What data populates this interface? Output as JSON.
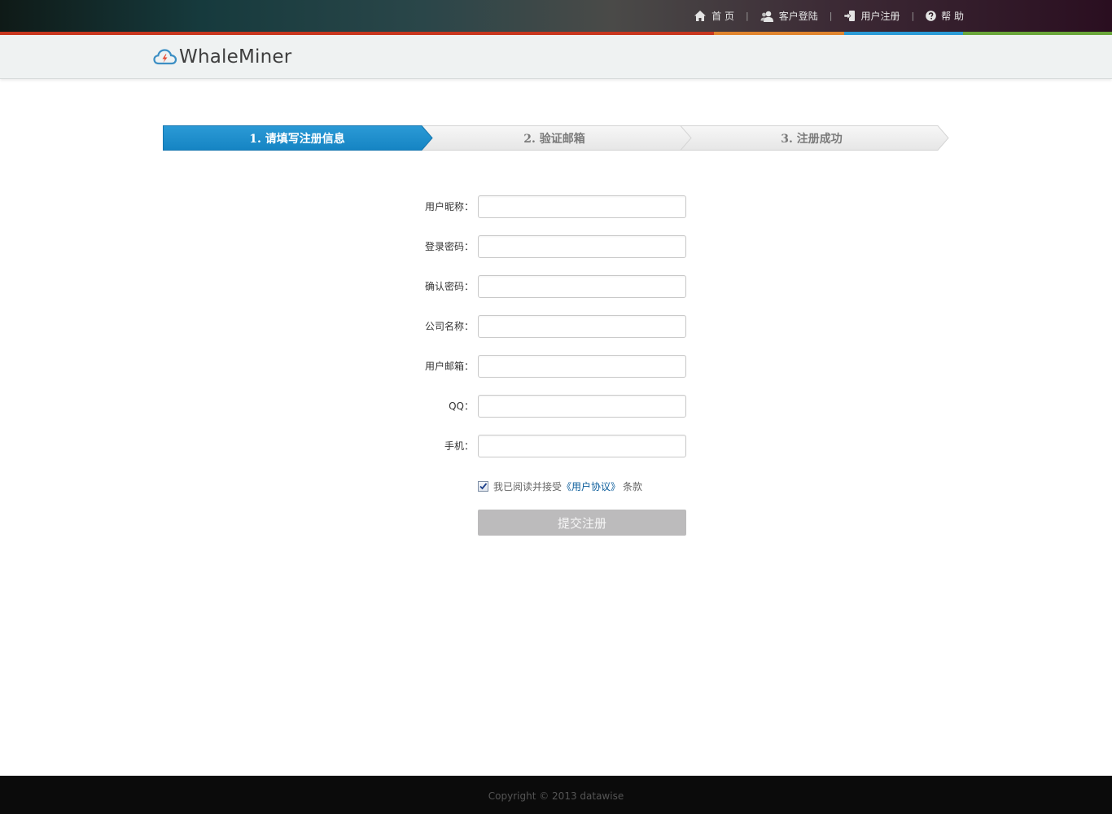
{
  "topnav": {
    "home": "首 页",
    "login": "客户登陆",
    "register": "用户注册",
    "help": "帮 助",
    "separator": "|"
  },
  "colors": {
    "accent_blue": "#1a8bc8",
    "stripe_red": "#c8371f",
    "stripe_orange": "#e0852e",
    "stripe_blue": "#2a9bd6",
    "stripe_green": "#6aa63a",
    "button_disabled": "#bcbbbc",
    "link": "#0a5c9b"
  },
  "header": {
    "logo_text": "WhaleMiner"
  },
  "steps": [
    {
      "label": "1. 请填写注册信息",
      "active": true
    },
    {
      "label": "2. 验证邮箱",
      "active": false
    },
    {
      "label": "3. 注册成功",
      "active": false
    }
  ],
  "form": {
    "fields": [
      {
        "label": "用户昵称：",
        "value": ""
      },
      {
        "label": "登录密码：",
        "value": ""
      },
      {
        "label": "确认密码：",
        "value": ""
      },
      {
        "label": "公司名称：",
        "value": ""
      },
      {
        "label": "用户邮箱：",
        "value": ""
      },
      {
        "label": "QQ：",
        "value": ""
      },
      {
        "label": "手机：",
        "value": ""
      }
    ],
    "agree_prefix": "我已阅读并接受",
    "agree_link": "《用户协议》",
    "agree_suffix": "条款",
    "agree_checked": true,
    "submit_label": "提交注册"
  },
  "footer": {
    "copyright": "Copyright © 2013 datawise"
  }
}
